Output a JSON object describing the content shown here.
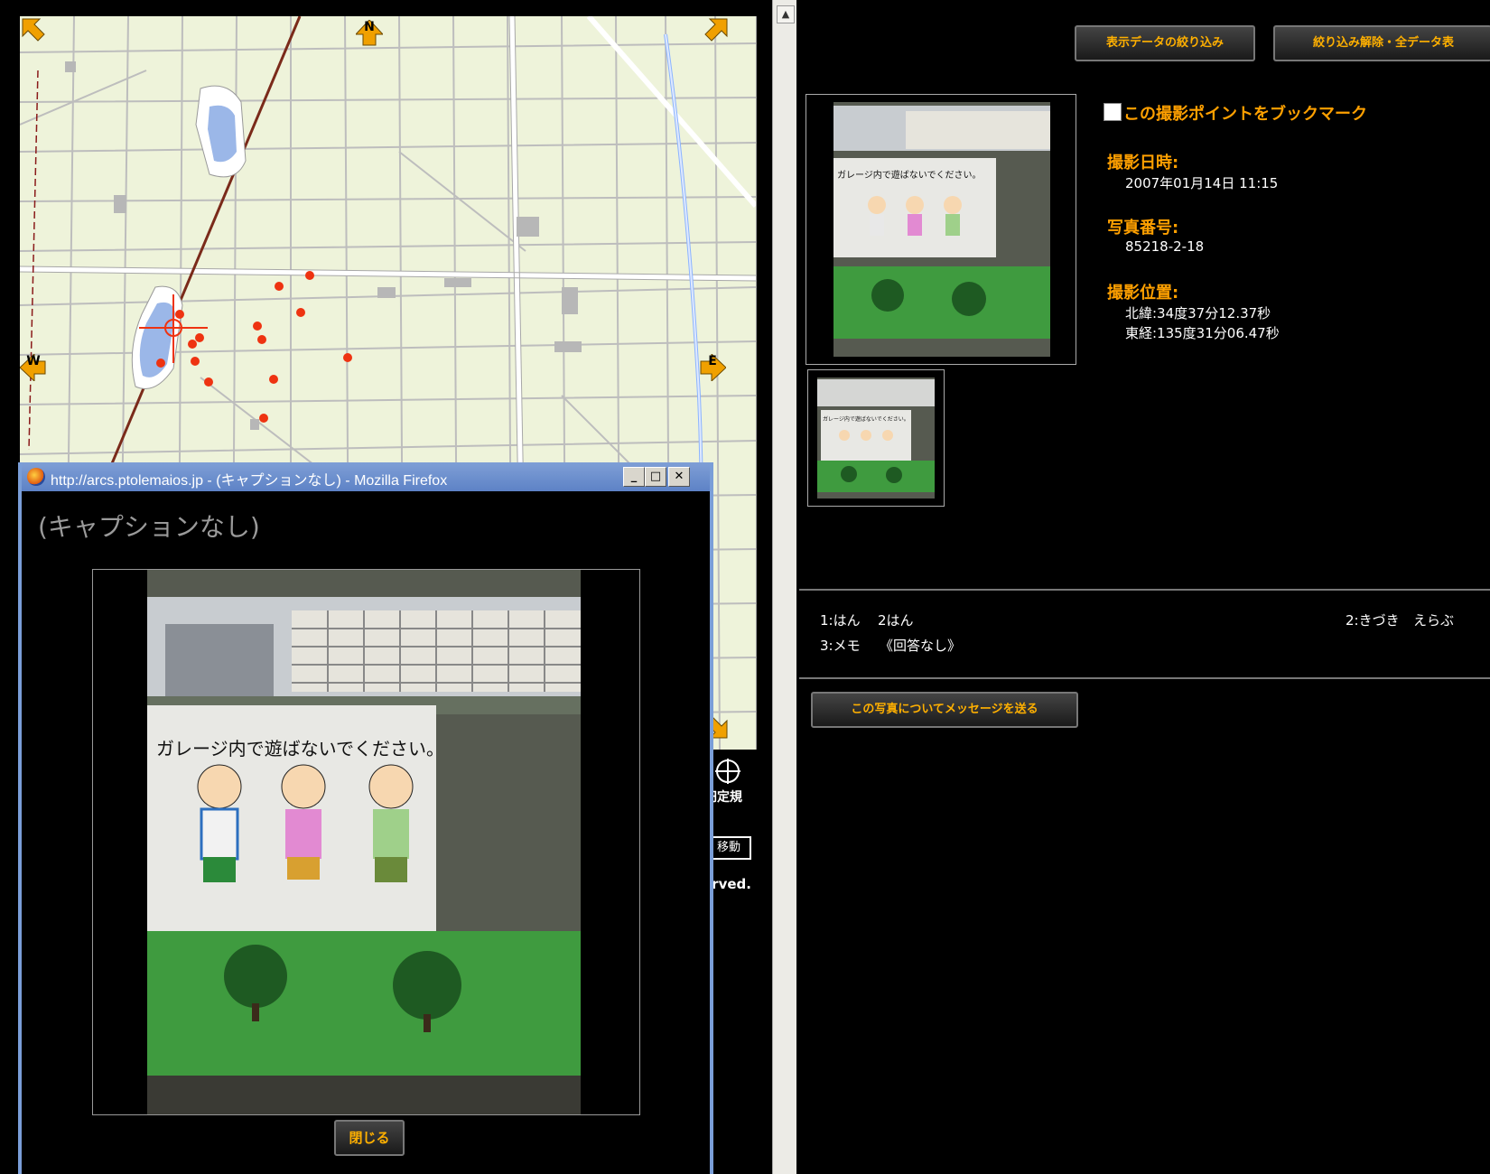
{
  "map": {
    "compass": {
      "north": "N",
      "west": "W",
      "east": "E"
    },
    "tools": {
      "circle_measure_label": "円定規",
      "move_button": "移動",
      "copyright_fragment": "erved."
    }
  },
  "popup": {
    "window_title": "http://arcs.ptolemaios.jp - (キャプションなし) - Mozilla Firefox",
    "minimize": "_",
    "maximize": "□",
    "close_x": "✕",
    "caption": "(キャプションなし)",
    "photo_sign_text": "ガレージ内で遊ばないでください。",
    "close_button": "閉じる"
  },
  "panel": {
    "filter_button": "表示データの絞り込み",
    "reset_button": "絞り込み解除・全データ表",
    "bookmark_label": "この撮影ポイントをブックマーク",
    "bookmark_checked": false,
    "shot_datetime_label": "撮影日時:",
    "shot_datetime": "2007年01月14日 11:15",
    "photo_number_label": "写真番号:",
    "photo_number": "85218-2-18",
    "position_label": "撮影位置:",
    "latitude": "北緯:34度37分12.37秒",
    "longitude": "東経:135度31分06.47秒",
    "thumb_sign_text": "ガレージ内で遊ばないでください。",
    "answers": {
      "q1_label": "1:はん",
      "q1_value": "2はん",
      "q2_label": "2:きづき",
      "q2_value": "えらぶ",
      "q3_label": "3:メモ",
      "q3_value": "《回答なし》"
    },
    "message_button": "この写真についてメッセージを送る"
  },
  "colors": {
    "accent_orange": "#ffa000",
    "map_bg": "#eef3da",
    "marker_red": "#ee3311"
  }
}
